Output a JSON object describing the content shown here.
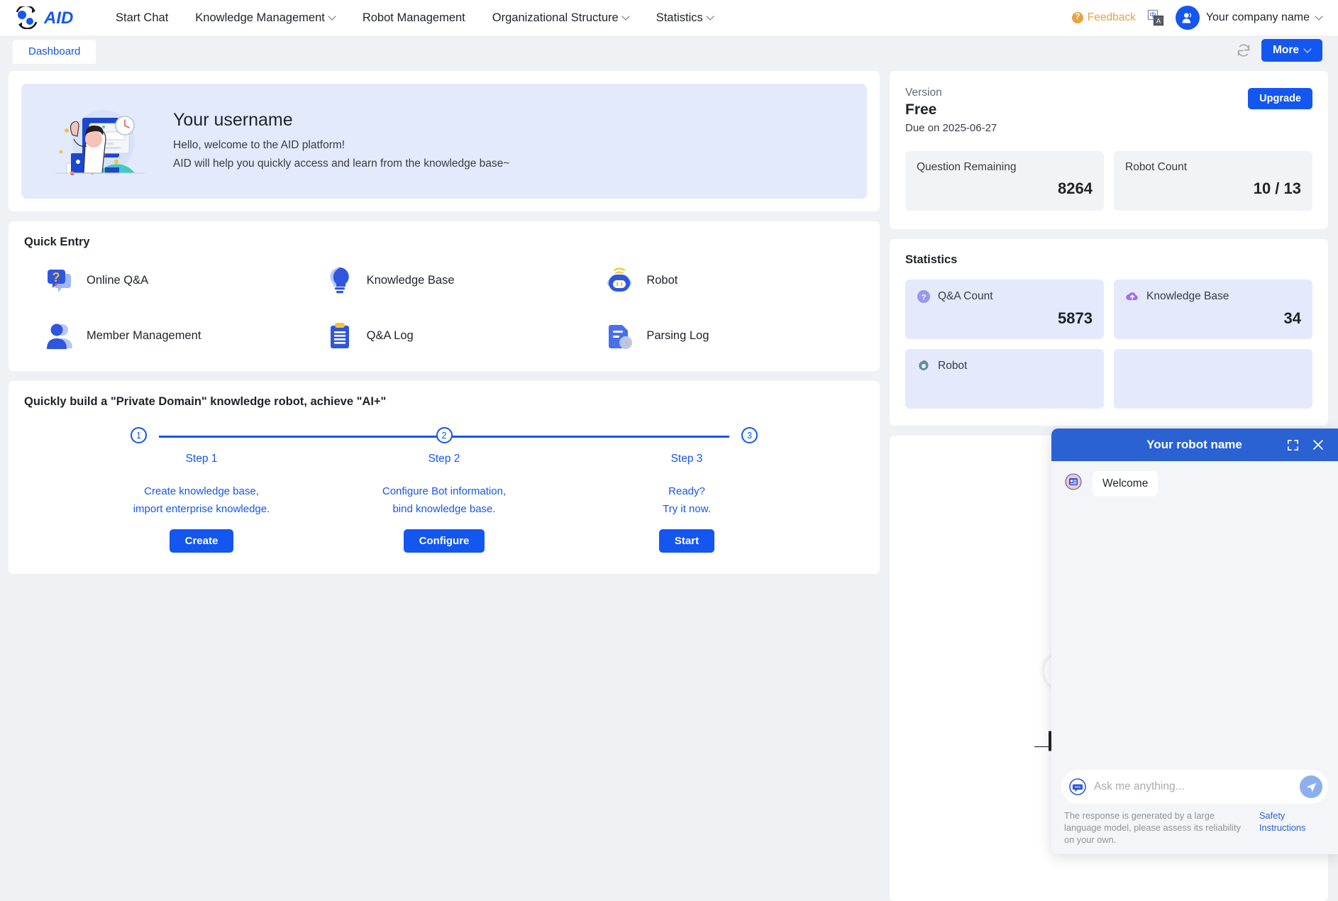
{
  "brand": {
    "name": "AID",
    "accent": "#1456f0"
  },
  "topnav": {
    "items": [
      {
        "label": "Start Chat",
        "caret": false
      },
      {
        "label": "Knowledge Management",
        "caret": true
      },
      {
        "label": "Robot Management",
        "caret": false
      },
      {
        "label": "Organizational Structure",
        "caret": true
      },
      {
        "label": "Statistics",
        "caret": true
      }
    ],
    "feedback_label": "Feedback",
    "translate_icon": "translate-icon",
    "account_name": "Your company name"
  },
  "tabstrip": {
    "tabs": [
      {
        "label": "Dashboard",
        "active": true
      }
    ],
    "refresh_icon": "refresh-icon",
    "more_label": "More"
  },
  "welcome": {
    "title": "Your username",
    "line1": "Hello, welcome to the AID platform!",
    "line2": "AID will help you quickly access and learn from the knowledge base~",
    "illustration": "welcome-illustration"
  },
  "quick_entry": {
    "title": "Quick Entry",
    "items": [
      {
        "label": "Online Q&A",
        "icon": "question-bubble-icon"
      },
      {
        "label": "Knowledge Base",
        "icon": "lightbulb-icon"
      },
      {
        "label": "Robot",
        "icon": "robot-icon"
      },
      {
        "label": "Member Management",
        "icon": "users-icon"
      },
      {
        "label": "Q&A Log",
        "icon": "clipboard-icon"
      },
      {
        "label": "Parsing Log",
        "icon": "document-clock-icon"
      }
    ]
  },
  "steps": {
    "title": "Quickly build a \"Private Domain\" knowledge robot, achieve \"AI+\"",
    "items": [
      {
        "num": "1",
        "name": "Step 1",
        "desc_line1": "Create knowledge base,",
        "desc_line2": "import enterprise knowledge.",
        "button": "Create"
      },
      {
        "num": "2",
        "name": "Step 2",
        "desc_line1": "Configure Bot information,",
        "desc_line2": "bind knowledge base.",
        "button": "Configure"
      },
      {
        "num": "3",
        "name": "Step 3",
        "desc_line1": "Ready?",
        "desc_line2": "Try it now.",
        "button": "Start"
      }
    ]
  },
  "version": {
    "label": "Version",
    "name": "Free",
    "due": "Due on 2025-06-27",
    "upgrade_label": "Upgrade",
    "stats": [
      {
        "label": "Question Remaining",
        "value": "8264"
      },
      {
        "label": "Robot Count",
        "value": "10 / 13"
      }
    ]
  },
  "statistics": {
    "title": "Statistics",
    "boxes": [
      {
        "label": "Q&A Count",
        "value": "5873",
        "icon": "question-circle-icon",
        "icon_color": "#8f8ff0"
      },
      {
        "label": "Knowledge Base",
        "value": "34",
        "icon": "cloud-upload-icon",
        "icon_color": "#a06ff0"
      },
      {
        "label": "Robot",
        "value": "",
        "icon": "gear-icon",
        "icon_color": "#5f9094"
      },
      {
        "label": "",
        "value": "",
        "icon": "",
        "icon_color": "#5f9094"
      }
    ]
  },
  "illustration_panel": {
    "image": "person-climbing-stairs-illustration",
    "collapse_icon": "chevron-right-icon"
  },
  "chat": {
    "title": "Your robot name",
    "expand_icon": "expand-icon",
    "close_icon": "close-icon",
    "bot_avatar": "bot-avatar-icon",
    "messages": [
      {
        "from": "bot",
        "text": "Welcome"
      }
    ],
    "input_placeholder": "Ask me anything...",
    "input_value": "",
    "emoji_icon": "chat-bubble-icon",
    "send_icon": "send-icon",
    "disclaimer": "The response is generated by a large language model, please assess its reliability on your own.",
    "safety_link": "Safety Instructions"
  }
}
